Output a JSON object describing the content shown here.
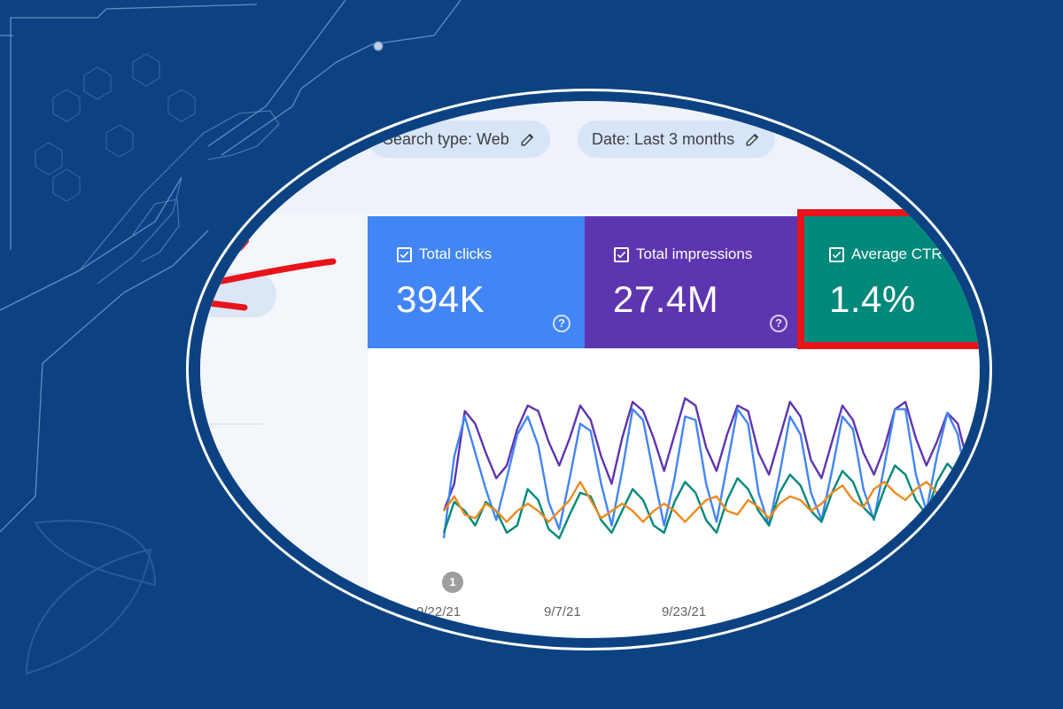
{
  "colors": {
    "background": "#0c4282",
    "clicks": "#4285f4",
    "impressions": "#5e35b1",
    "ctr": "#00897b",
    "position": "#ef8a1f",
    "highlight": "#e8141a"
  },
  "filters": {
    "search_type": "Search type: Web",
    "date": "Date: Last 3 months"
  },
  "metrics": [
    {
      "label": "Total clicks",
      "value": "394K",
      "checked": true,
      "icon": "help-icon"
    },
    {
      "label": "Total impressions",
      "value": "27.4M",
      "checked": true,
      "icon": "help-icon"
    },
    {
      "label": "Average CTR",
      "value": "1.4%",
      "checked": true
    }
  ],
  "annotation": {
    "badge": "1"
  },
  "chart_data": {
    "type": "line",
    "x_ticks": [
      "9/22/21",
      "9/7/21",
      "9/23/21"
    ],
    "series": [
      {
        "metric": "impressions",
        "color": "#5e35b1",
        "values": [
          0.3,
          0.45,
          0.85,
          0.78,
          0.62,
          0.48,
          0.55,
          0.75,
          0.88,
          0.85,
          0.68,
          0.55,
          0.7,
          0.88,
          0.8,
          0.6,
          0.45,
          0.7,
          0.9,
          0.85,
          0.7,
          0.52,
          0.72,
          0.92,
          0.88,
          0.65,
          0.52,
          0.72,
          0.88,
          0.85,
          0.62,
          0.5,
          0.7,
          0.9,
          0.82,
          0.58,
          0.48,
          0.68,
          0.88,
          0.8,
          0.62,
          0.5,
          0.65,
          0.86,
          0.9,
          0.7,
          0.55,
          0.68,
          0.84,
          0.78,
          0.55,
          0.48
        ]
      },
      {
        "metric": "clicks",
        "color": "#4285f4",
        "values": [
          0.15,
          0.6,
          0.82,
          0.62,
          0.42,
          0.25,
          0.48,
          0.72,
          0.82,
          0.66,
          0.35,
          0.2,
          0.48,
          0.78,
          0.74,
          0.45,
          0.22,
          0.52,
          0.86,
          0.8,
          0.5,
          0.22,
          0.48,
          0.82,
          0.8,
          0.45,
          0.24,
          0.55,
          0.86,
          0.78,
          0.4,
          0.22,
          0.5,
          0.82,
          0.72,
          0.4,
          0.25,
          0.52,
          0.82,
          0.75,
          0.42,
          0.25,
          0.55,
          0.86,
          0.86,
          0.5,
          0.3,
          0.6,
          0.84,
          0.72,
          0.4,
          0.35
        ]
      },
      {
        "metric": "ctr",
        "color": "#00897b",
        "values": [
          0.18,
          0.35,
          0.3,
          0.22,
          0.35,
          0.3,
          0.18,
          0.22,
          0.42,
          0.36,
          0.2,
          0.15,
          0.28,
          0.4,
          0.38,
          0.25,
          0.18,
          0.3,
          0.42,
          0.36,
          0.22,
          0.18,
          0.35,
          0.46,
          0.4,
          0.25,
          0.18,
          0.36,
          0.48,
          0.42,
          0.3,
          0.22,
          0.4,
          0.5,
          0.44,
          0.3,
          0.24,
          0.4,
          0.52,
          0.46,
          0.32,
          0.26,
          0.42,
          0.55,
          0.5,
          0.36,
          0.28,
          0.46,
          0.56,
          0.5,
          0.38,
          0.32
        ]
      },
      {
        "metric": "position",
        "color": "#ef8a1f",
        "values": [
          0.3,
          0.38,
          0.28,
          0.26,
          0.34,
          0.3,
          0.24,
          0.3,
          0.34,
          0.3,
          0.24,
          0.3,
          0.36,
          0.46,
          0.36,
          0.26,
          0.3,
          0.34,
          0.3,
          0.24,
          0.3,
          0.34,
          0.3,
          0.24,
          0.3,
          0.36,
          0.38,
          0.3,
          0.28,
          0.36,
          0.32,
          0.26,
          0.34,
          0.38,
          0.36,
          0.3,
          0.34,
          0.4,
          0.44,
          0.36,
          0.32,
          0.42,
          0.46,
          0.4,
          0.36,
          0.42,
          0.46,
          0.4,
          0.36,
          0.42,
          0.44,
          0.4
        ]
      }
    ]
  }
}
